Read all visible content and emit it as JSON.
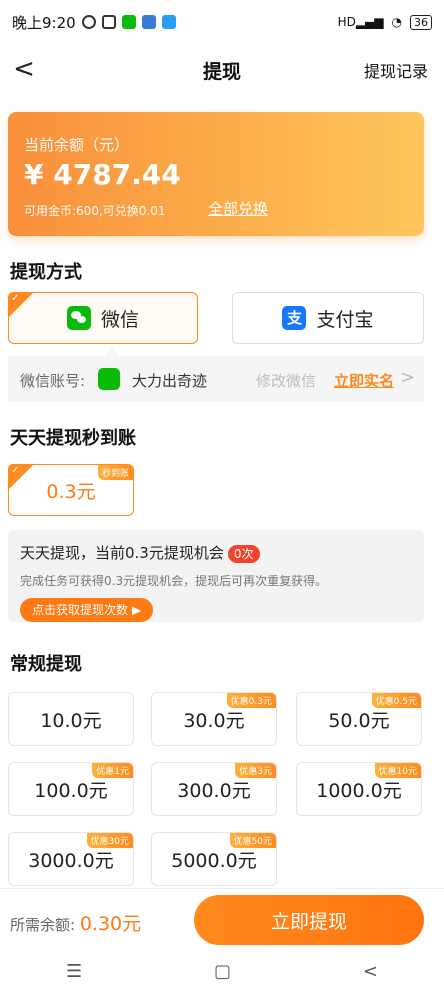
{
  "status_bar": {
    "time": "晚上9:20",
    "network": "HD",
    "battery": "36"
  },
  "nav": {
    "back": "<",
    "title": "提现",
    "records_link": "提现记录"
  },
  "balance": {
    "label": "当前余额（元）",
    "amount": "¥ 4787.44",
    "gold_info": "可用金币:600,可兑换0.01",
    "exchange_all": "全部兑换"
  },
  "method": {
    "title": "提现方式",
    "wechat": "微信",
    "alipay": "支付宝",
    "selected": "wechat",
    "account_label": "微信账号:",
    "account_name": "大力出奇迹",
    "modify": "修改微信",
    "verify": "立即实名",
    "chevron": ">"
  },
  "daily": {
    "title": "天天提现秒到账",
    "option": {
      "amount": "0.3元",
      "tag": "秒到账"
    },
    "tip_prefix": "天天提现，当前0.3元提现机会",
    "tip_count": "0次",
    "tip_desc": "完成任务可获得0.3元提现机会，提现后可再次重复获得。",
    "tip_button": "点击获取提现次数 ▶"
  },
  "regular": {
    "title": "常规提现",
    "options": [
      {
        "amount": "10.0元",
        "tag": ""
      },
      {
        "amount": "30.0元",
        "tag": "优惠0.3元"
      },
      {
        "amount": "50.0元",
        "tag": "优惠0.5元"
      },
      {
        "amount": "100.0元",
        "tag": "优惠1元"
      },
      {
        "amount": "300.0元",
        "tag": "优惠3元"
      },
      {
        "amount": "1000.0元",
        "tag": "优惠10元"
      },
      {
        "amount": "3000.0元",
        "tag": "优惠30元"
      },
      {
        "amount": "5000.0元",
        "tag": "优惠50元"
      }
    ]
  },
  "footer": {
    "need_label": "所需余额:",
    "need_amount": "0.30元",
    "withdraw_button": "立即提现"
  },
  "system_nav": {
    "menu": "☰",
    "home": "▢",
    "back": "<"
  },
  "colors": {
    "accent": "#ff8a1e",
    "wechat": "#09bb07",
    "alipay": "#1677ff"
  }
}
